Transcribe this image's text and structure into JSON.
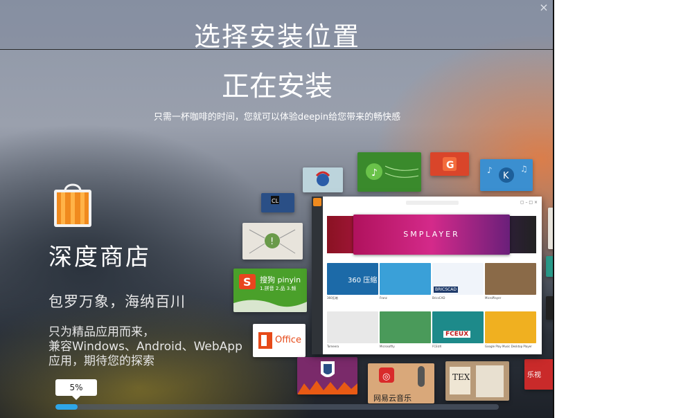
{
  "window": {
    "title": "选择安装位置",
    "close_glyph": "×"
  },
  "install": {
    "heading": "正在安装",
    "subtitle": "只需一杯咖啡的时间，您就可以体验deepin给您带来的畅快感"
  },
  "slide": {
    "store_name": "深度商店",
    "slogan": "包罗万象，海纳百川",
    "description": "只为精品应用而来，\n兼容Windows、Android、WebApp\n应用，期待您的探索"
  },
  "tiles": {
    "sogou": "搜狗 pinyin",
    "sogou_sub": "1.拼音 2.品 3.频",
    "office": "Office",
    "netease": "网易云音乐",
    "tex": "TEX",
    "letv": "乐视",
    "smplayer": "SMPLAYER"
  },
  "store_window": {
    "apps_row1": [
      "360压缩",
      "Franz",
      "BricsCAD",
      "MicroPlayer"
    ],
    "apps_row2": [
      "Tomeera",
      "Microsoftly",
      "FCEUX",
      "Google Play Music Desktop Player"
    ],
    "fceux_label": "FCEUX",
    "bricscad_label": "BRICSCAD",
    "zip_label": "360 压缩"
  },
  "progress": {
    "percent": 5,
    "label": "5%"
  },
  "colors": {
    "accent": "#2ea6e8",
    "bag_orange": "#f08a1e"
  }
}
